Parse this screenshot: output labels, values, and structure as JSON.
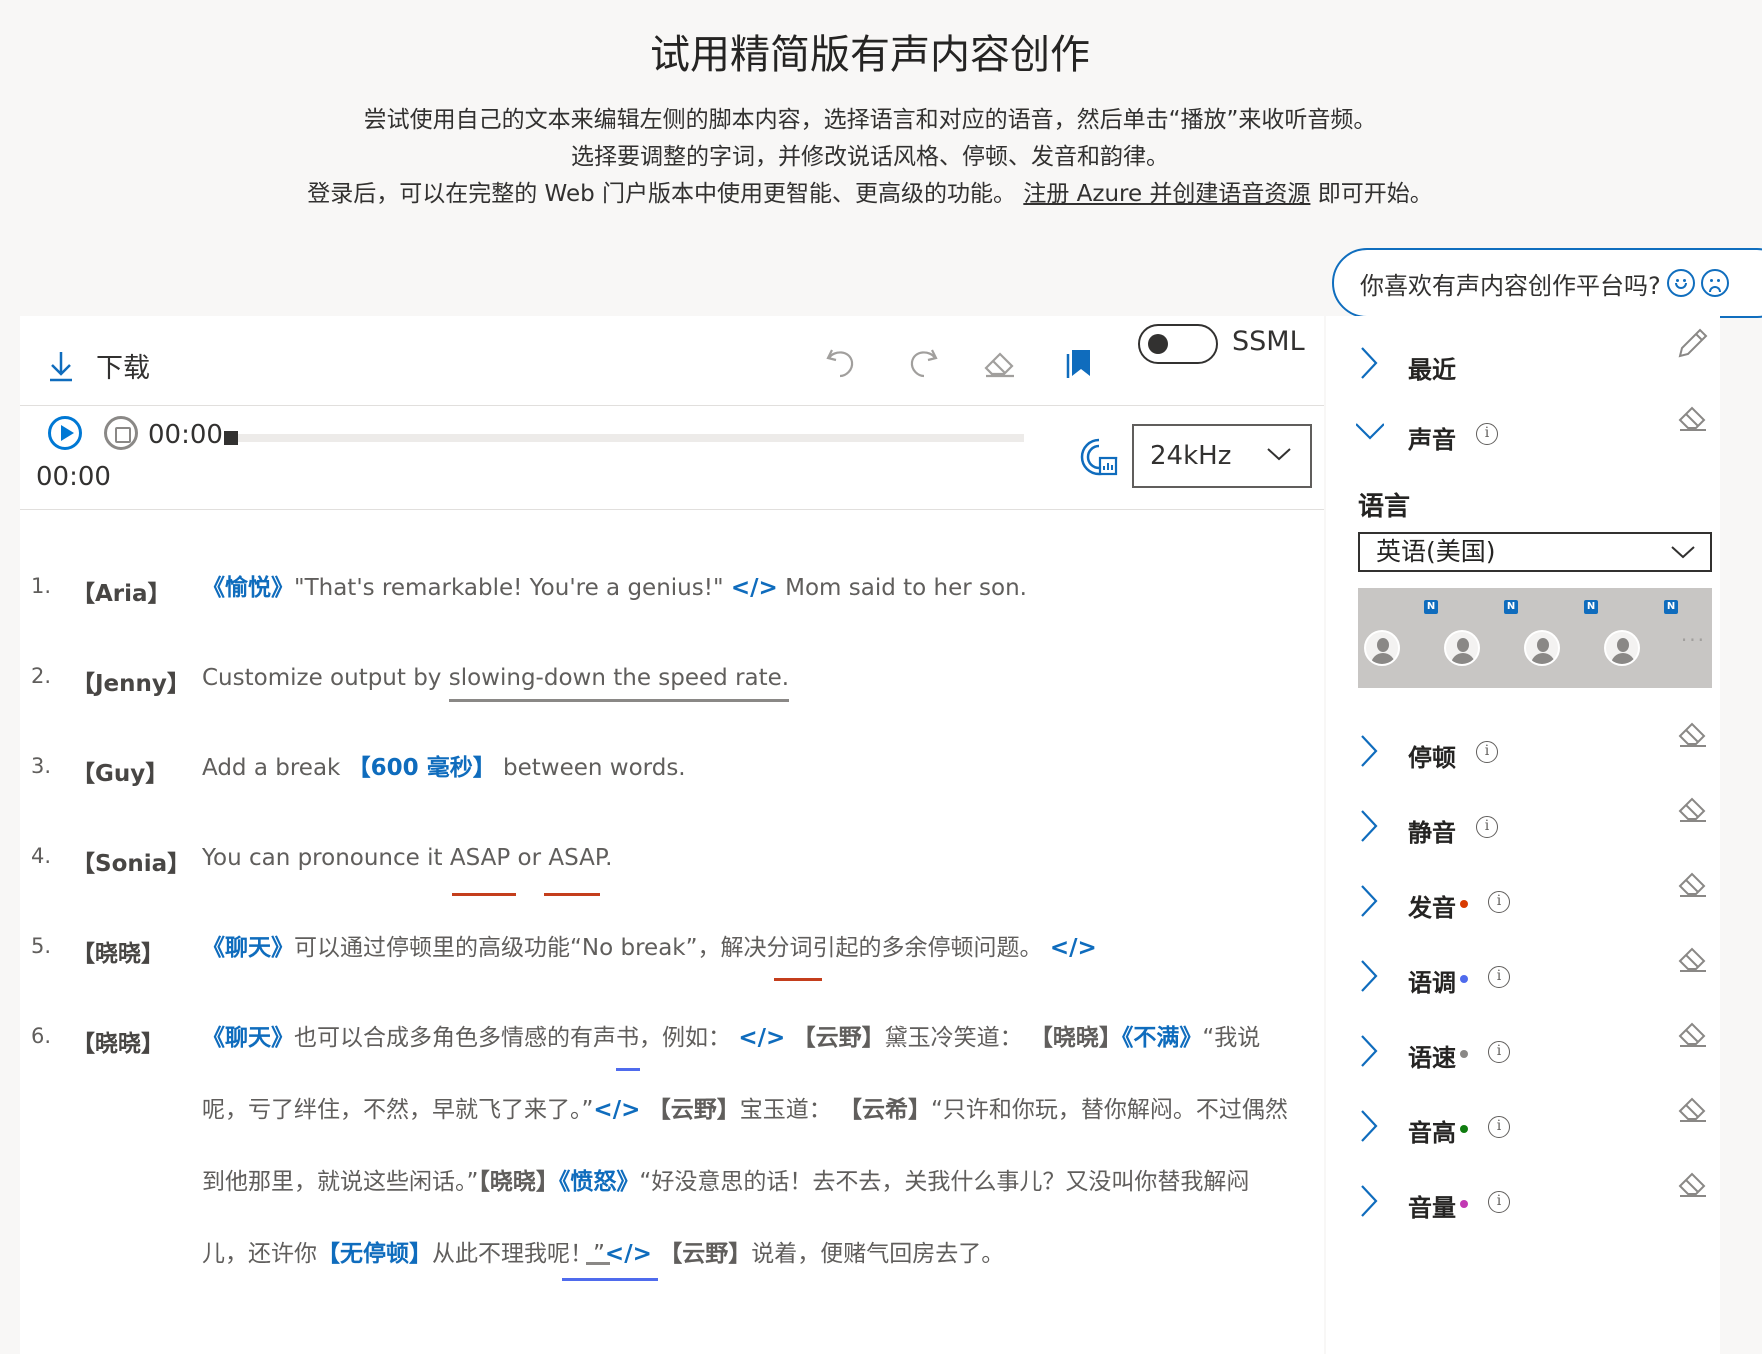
{
  "header": {
    "title": "试用精简版有声内容创作",
    "desc_line1": "尝试使用自己的文本来编辑左侧的脚本内容，选择语言和对应的语音，然后单击“播放”来收听音频。",
    "desc_line2": "选择要调整的字词，并修改说话风格、停顿、发音和韵律。",
    "desc_line3_pre": "登录后，可以在完整的 Web 门户版本中使用更智能、更高级的功能。",
    "desc_line3_link": "注册 Azure 并创建语音资源",
    "desc_line3_post": "即可开始。"
  },
  "feedback": {
    "question": "你喜欢有声内容创作平台吗?"
  },
  "toolbar": {
    "download_label": "下载",
    "ssml_label": "SSML",
    "ssml_on": false
  },
  "player": {
    "current_time": "00:00",
    "total_time": "00:00",
    "progress": 0,
    "sample_rate": "24kHz"
  },
  "script": {
    "lines": [
      {
        "num": "1.",
        "speaker": "【Aria】",
        "tag_open": "《愉悦》",
        "text": "\"That's remarkable! You're a genius!\"",
        "tag_close": "</>",
        "text2": "Mom said to her son."
      },
      {
        "num": "2.",
        "speaker": "【Jenny】",
        "text_pre": "Customize output by ",
        "text_ul": "slowing-down the speed rate."
      },
      {
        "num": "3.",
        "speaker": "【Guy】",
        "text_pre": "Add a break ",
        "tag": "【600 毫秒】",
        "text_post": " between words."
      },
      {
        "num": "4.",
        "speaker": "【Sonia】",
        "text": "You can pronounce it ASAP or ASAP."
      },
      {
        "num": "5.",
        "speaker": "【晓晓】",
        "tag_open": "《聊天》",
        "text": "可以通过停顿里的高级功能“No break”，解决分词引起的多余停顿问题。",
        "tag_close": "</>"
      },
      {
        "num": "6.",
        "speaker": "【晓晓】",
        "seg1_tag": "《聊天》",
        "seg1": "也可以合成多角色多情感的有声书，例如：",
        "seg1_close": "</>",
        "seg2_spk": "【云野】",
        "seg2": "黛玉冷笑道：",
        "seg3_spk": "【晓晓】",
        "seg3_tag": "《不满》",
        "seg3": "“我说呢，亏了绊住，不然，早就飞了来了。”",
        "seg3_close": "</>",
        "seg4_spk": "【云野】",
        "seg4": "宝玉道：",
        "seg5_spk": "【云希】",
        "seg5": "“只许和你玩，替你解闷。不过偶然到他那里，就说这些闲话。”",
        "seg6_spk": "【晓晓】",
        "seg6_tag": "《愤怒》",
        "seg6": "“好没意思的话！去不去，关我什么事儿？又没叫你替我解闷儿，还许你",
        "seg6_tag2": "【无停顿】",
        "seg6b": "从此不理我呢！”",
        "seg6_close": "</>",
        "seg7_spk": "【云野】",
        "seg7": "说着，便赌气回房去了。"
      }
    ]
  },
  "side": {
    "recent": "最近",
    "voice": "声音",
    "language_label": "语言",
    "language_value": "英语(美国)",
    "voice_badge": "N",
    "sections": [
      {
        "label": "停顿",
        "dot": ""
      },
      {
        "label": "静音",
        "dot": ""
      },
      {
        "label": "发音",
        "dot": "#d83b01"
      },
      {
        "label": "语调",
        "dot": "#4f6bed"
      },
      {
        "label": "语速",
        "dot": "#8a8886"
      },
      {
        "label": "音高",
        "dot": "#107c10"
      },
      {
        "label": "音量",
        "dot": "#c239b3"
      }
    ]
  },
  "colors": {
    "accent": "#0f6cbd",
    "tag": "#0f6cbd",
    "mark_orange": "#c43e1c",
    "mark_blue": "#4f6bed"
  }
}
